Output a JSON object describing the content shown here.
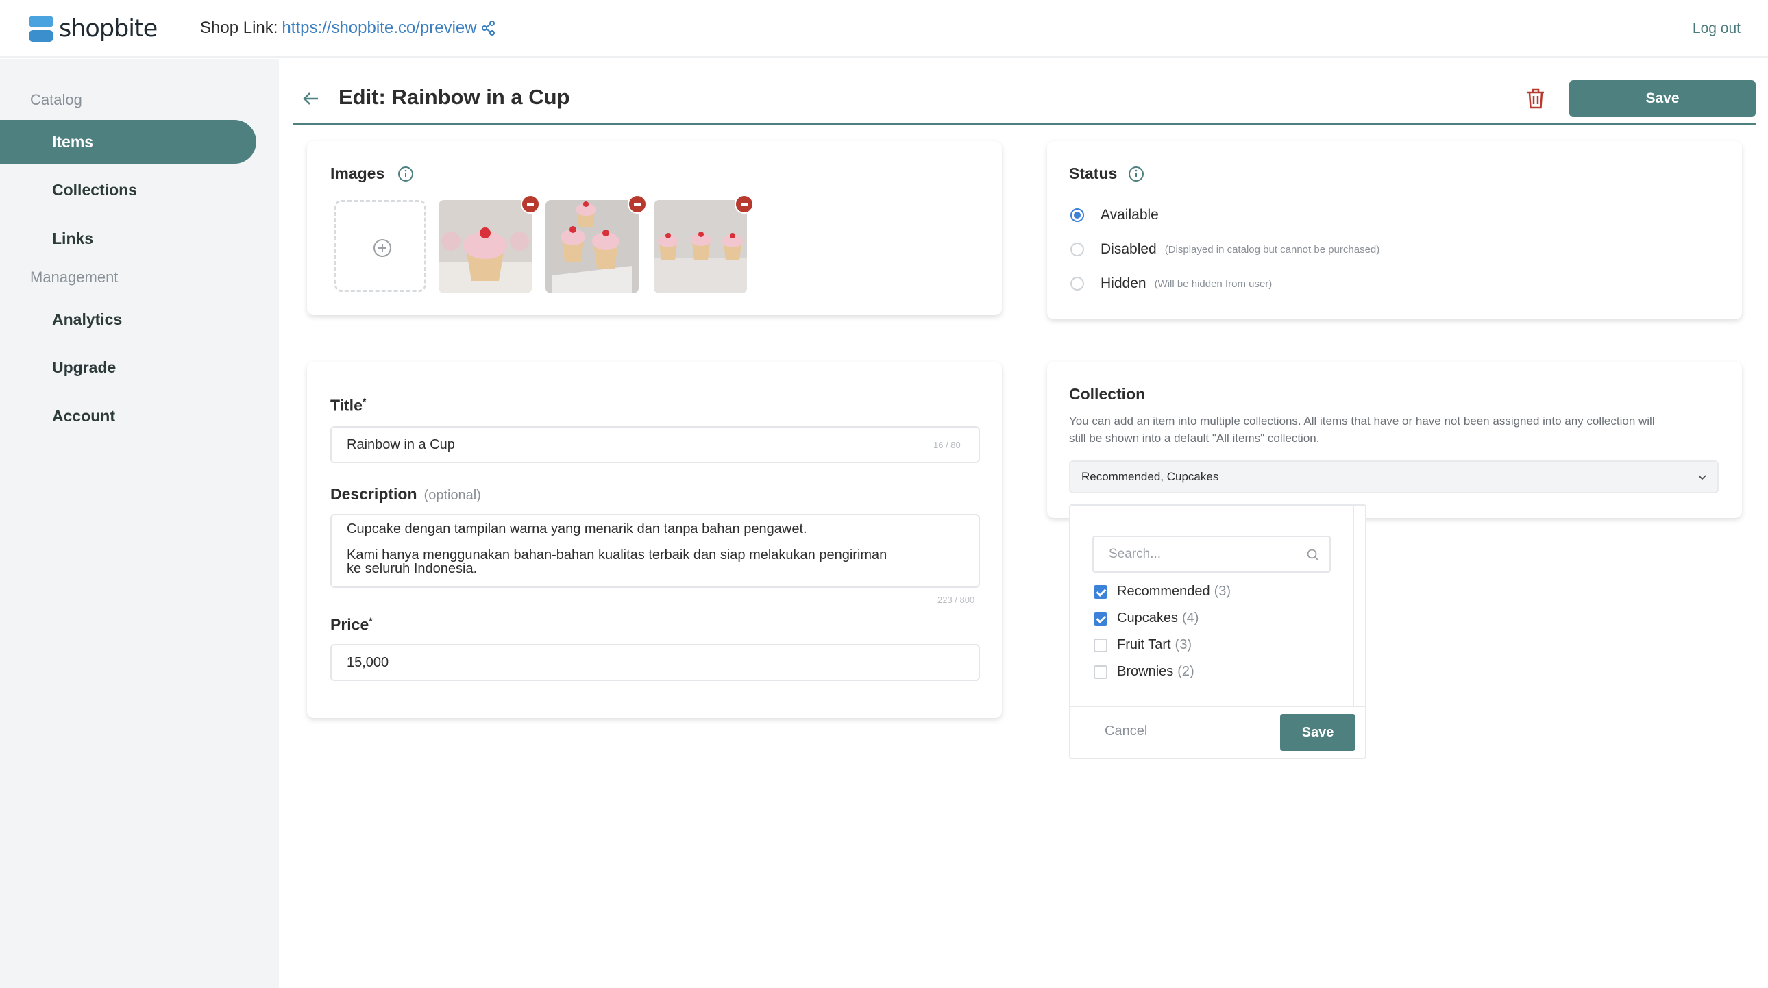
{
  "app": {
    "name": "shopbite"
  },
  "topbar": {
    "shop_link_label": "Shop Link:",
    "shop_link_url": "https://shopbite.co/preview",
    "logout_label": "Log out"
  },
  "sidebar": {
    "groups": [
      {
        "label": "Catalog"
      },
      {
        "label": "Management"
      }
    ],
    "items": [
      {
        "label": "Items",
        "active": true
      },
      {
        "label": "Collections"
      },
      {
        "label": "Links"
      },
      {
        "label": "Analytics"
      },
      {
        "label": "Upgrade"
      },
      {
        "label": "Account"
      }
    ]
  },
  "header": {
    "title": "Edit: Rainbow in a Cup",
    "save_label": "Save"
  },
  "images": {
    "title": "Images",
    "count": 3
  },
  "status": {
    "title": "Status",
    "options": [
      {
        "label": "Available",
        "hint": "",
        "selected": true
      },
      {
        "label": "Disabled",
        "hint": "(Displayed in catalog but cannot be purchased)",
        "selected": false
      },
      {
        "label": "Hidden",
        "hint": "(Will be hidden from user)",
        "selected": false
      }
    ]
  },
  "form": {
    "title_label": "Title",
    "title_value": "Rainbow in a Cup",
    "title_counter": "16 / 80",
    "description_label": "Description",
    "description_optional": "(optional)",
    "description_line1": "Cupcake dengan tampilan warna yang menarik dan tanpa bahan pengawet.",
    "description_line2": "Kami hanya menggunakan bahan-bahan kualitas terbaik dan siap melakukan pengiriman",
    "description_line3": "ke seluruh Indonesia.",
    "description_counter": "223 / 800",
    "price_label": "Price",
    "price_value": "15,000"
  },
  "collection": {
    "title": "Collection",
    "description_line1": "You can add an item into multiple collections. All items that have or have not been assigned into any collection will",
    "description_line2": "still be shown into a default \"All items\" collection.",
    "selected": "Recommended, Cupcakes",
    "dropdown": {
      "search_placeholder": "Search...",
      "options": [
        {
          "label": "Recommended",
          "count": "(3)",
          "checked": true
        },
        {
          "label": "Cupcakes",
          "count": "(4)",
          "checked": true
        },
        {
          "label": "Fruit Tart",
          "count": "(3)",
          "checked": false
        },
        {
          "label": "Brownies",
          "count": "(2)",
          "checked": false
        }
      ],
      "cancel_label": "Cancel",
      "save_label": "Save"
    }
  },
  "colors": {
    "accent": "#4f8080",
    "link": "#3b7fc0",
    "danger": "#b83a2e",
    "check": "#3b82d8"
  }
}
